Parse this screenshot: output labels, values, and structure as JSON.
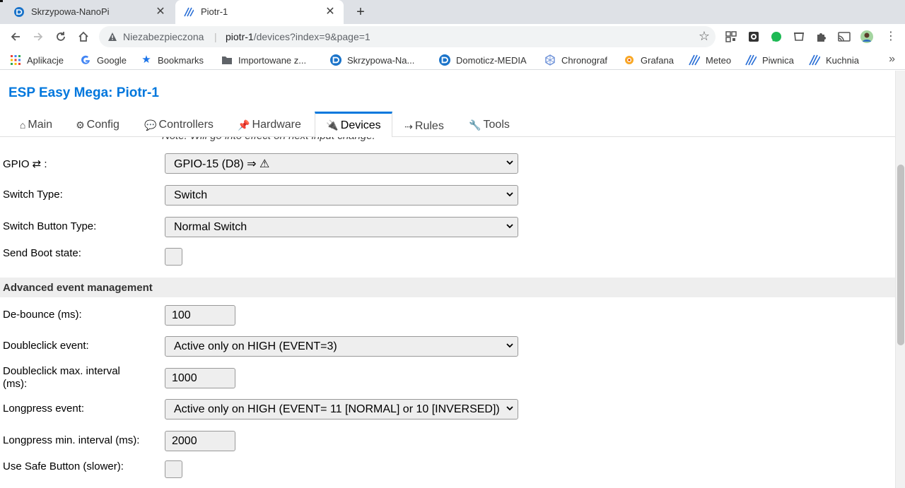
{
  "browser": {
    "tabs": [
      {
        "title": "Skrzypowa-NanoPi",
        "active": false
      },
      {
        "title": "Piotr-1",
        "active": true
      }
    ],
    "address": {
      "security_label": "Niezabezpieczona",
      "host": "piotr-1",
      "path": "/devices?index=9&page=1"
    },
    "bookmarks": [
      {
        "label": "Aplikacje",
        "icon": "apps-grid-icon"
      },
      {
        "label": "Google",
        "icon": "google-icon"
      },
      {
        "label": "Bookmarks",
        "icon": "star-icon"
      },
      {
        "label": "Importowane z...",
        "icon": "folder-icon"
      },
      {
        "label": "Skrzypowa-Na...",
        "icon": "domoticz-icon"
      },
      {
        "label": "Domoticz-MEDIA",
        "icon": "domoticz-icon"
      },
      {
        "label": "Chronograf",
        "icon": "chronograf-icon"
      },
      {
        "label": "Grafana",
        "icon": "grafana-icon"
      },
      {
        "label": "Meteo",
        "icon": "esp-easy-icon"
      },
      {
        "label": "Piwnica",
        "icon": "esp-easy-icon"
      },
      {
        "label": "Kuchnia",
        "icon": "esp-easy-icon"
      }
    ],
    "more_label": "»"
  },
  "app": {
    "title": "ESP Easy Mega: Piotr-1",
    "menu": [
      {
        "icon": "⌂",
        "label": "Main",
        "active": false
      },
      {
        "icon": "⚙",
        "label": "Config",
        "active": false
      },
      {
        "icon": "💬",
        "label": "Controllers",
        "active": false
      },
      {
        "icon": "📌",
        "label": "Hardware",
        "active": false
      },
      {
        "icon": "🔌",
        "label": "Devices",
        "active": true
      },
      {
        "icon": "⇢",
        "label": "Rules",
        "active": false
      },
      {
        "icon": "🔧",
        "label": "Tools",
        "active": false
      }
    ]
  },
  "form": {
    "note": "Note: Will go into effect on next input change.",
    "gpio": {
      "label": "GPIO ⇄ :",
      "value": "GPIO-15 (D8) ⇒ ⚠"
    },
    "switch_type": {
      "label": "Switch Type:",
      "value": "Switch"
    },
    "switch_button_type": {
      "label": "Switch Button Type:",
      "value": "Normal Switch"
    },
    "send_boot_state": {
      "label": "Send Boot state:",
      "checked": false
    },
    "advanced_section": "Advanced event management",
    "debounce": {
      "label": "De-bounce (ms):",
      "value": "100"
    },
    "doubleclick_event": {
      "label": "Doubleclick event:",
      "value": "Active only on HIGH (EVENT=3)"
    },
    "doubleclick_interval": {
      "label_line1": "Doubleclick max. interval",
      "label_line2": "(ms):",
      "value": "1000"
    },
    "longpress_event": {
      "label": "Longpress event:",
      "value": "Active only on HIGH (EVENT= 11 [NORMAL] or 10 [INVERSED])"
    },
    "longpress_interval": {
      "label": "Longpress min. interval (ms):",
      "value": "2000"
    },
    "safe_button": {
      "label": "Use Safe Button (slower):",
      "checked": false
    }
  }
}
